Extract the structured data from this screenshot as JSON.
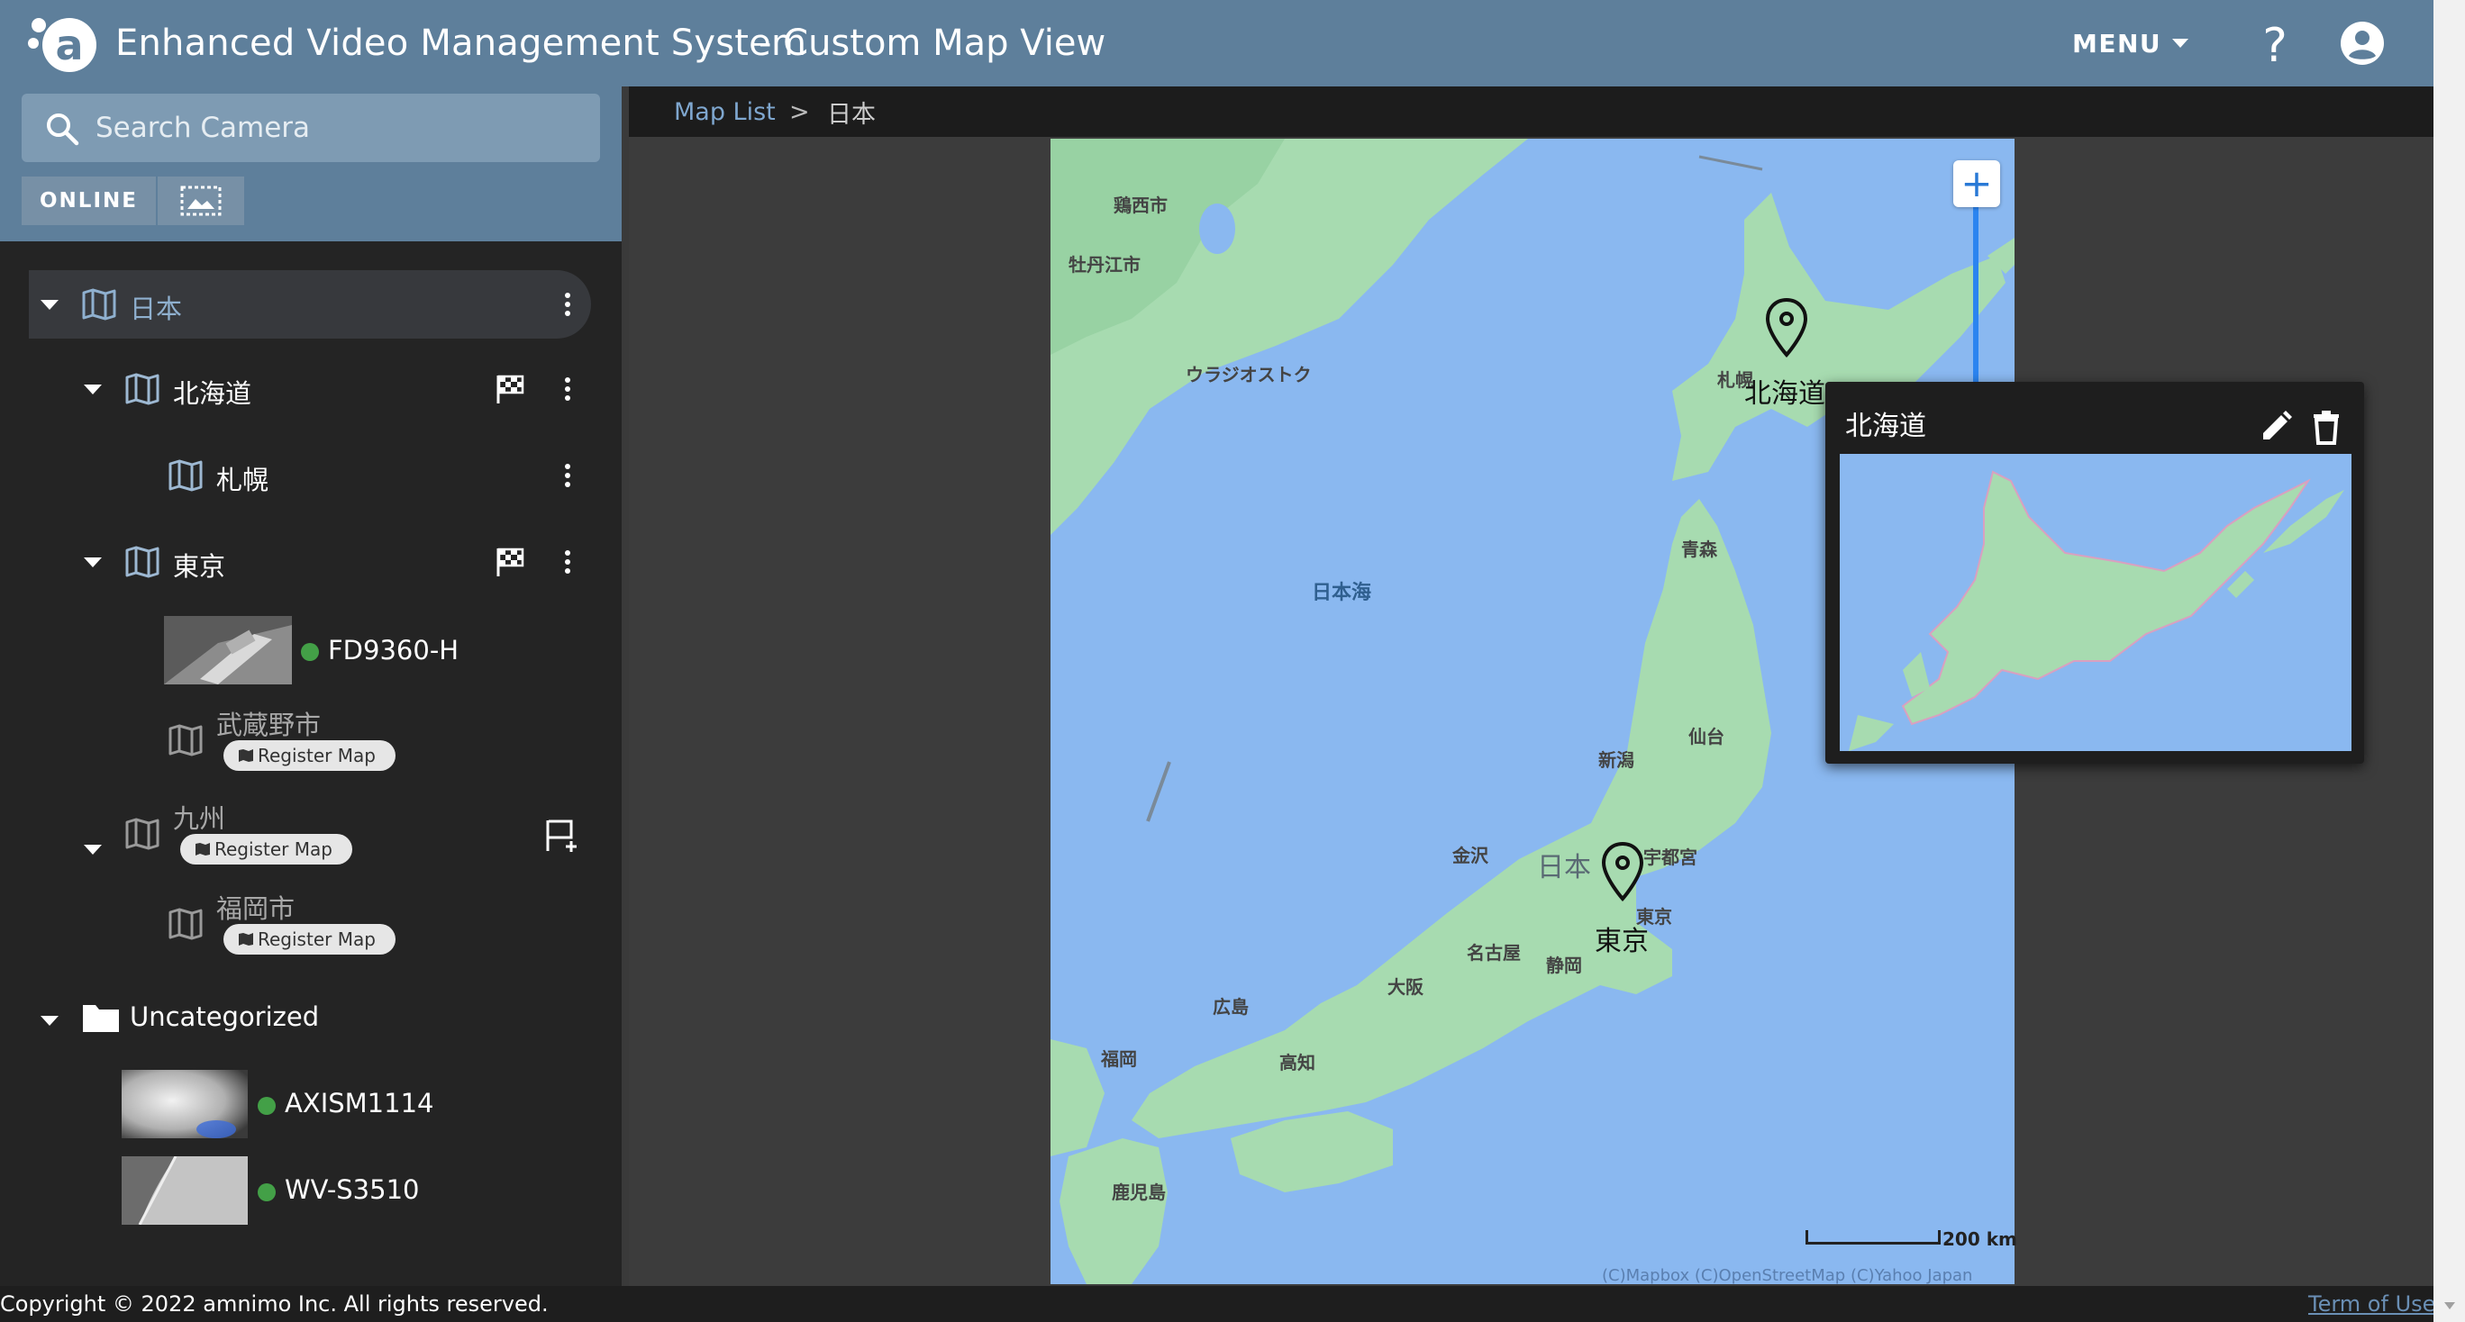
{
  "header": {
    "app_title": "Enhanced Video Management System",
    "page_title": "- Custom Map View",
    "menu_label": "MENU"
  },
  "sidebar": {
    "search_placeholder": "Search Camera",
    "online_label": "ONLINE",
    "register_map_label": "Register Map",
    "tree": {
      "root": "日本",
      "hokkaido": "北海道",
      "sapporo": "札幌",
      "tokyo": "東京",
      "musashino": "武蔵野市",
      "kyushu": "九州",
      "fukuoka": "福岡市",
      "uncategorized": "Uncategorized"
    },
    "cameras": {
      "fd9360": "FD9360-H",
      "axis": "AXISM1114",
      "wv": "WV-S3510"
    }
  },
  "breadcrumb": {
    "link": "Map List",
    "separator": ">",
    "current": "日本"
  },
  "map": {
    "labels": {
      "jixi": "鶏西市",
      "mudanjiang": "牡丹江市",
      "vladivostok": "ウラジオストク",
      "sapporo_city": "札幌",
      "aomori": "青森",
      "sea_of_japan": "日本海",
      "sendai": "仙台",
      "niigata": "新潟",
      "kanazawa": "金沢",
      "japan": "日本",
      "utsunomiya": "宇都宮",
      "tokyo_city": "東京",
      "nagoya": "名古屋",
      "shizuoka": "静岡",
      "osaka": "大阪",
      "hiroshima": "広島",
      "fukuoka_city": "福岡",
      "kochi": "高知",
      "kagoshima": "鹿児島"
    },
    "markers": {
      "hokkaido": "北海道",
      "tokyo": "東京"
    },
    "zoom_in": "+",
    "scale": "200 km",
    "attribution": "(C)Mapbox  (C)OpenStreetMap  (C)Yahoo Japan"
  },
  "popup": {
    "title": "北海道"
  },
  "footer": {
    "copyright": "Copyright © 2022 amnimo Inc. All rights reserved.",
    "terms": "Term of Use"
  },
  "colors": {
    "header": "#5e7f9b",
    "sidebar": "#242424",
    "sea": "#8ab8f0",
    "land": "#a7dbb0",
    "online": "#43a047"
  }
}
